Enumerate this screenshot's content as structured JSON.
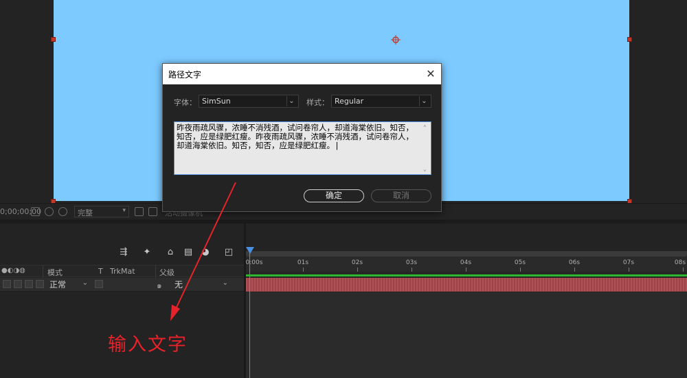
{
  "viewer": {
    "timecode": "0;00;00;00",
    "resolution": "完整",
    "extra_label": "活动摄像机"
  },
  "timeline": {
    "headers": {
      "mode": "模式",
      "t": "T",
      "trkmat": "TrkMat",
      "parent": "父级"
    },
    "row": {
      "mode_value": "正常",
      "parent_value": "无"
    },
    "ticks": [
      "0:00s",
      "01s",
      "02s",
      "03s",
      "04s",
      "05s",
      "06s",
      "07s",
      "08s"
    ]
  },
  "dialog": {
    "title": "路径文字",
    "font_label": "字体：",
    "font_value": "SimSun",
    "style_label": "样式：",
    "style_value": "Regular",
    "text": "昨夜雨疏风骤，浓睡不消残酒，试问卷帘人，却道海棠依旧。知否，知否，应是绿肥红瘦。昨夜雨疏风骤，浓睡不消残酒，试问卷帘人，却道海棠依旧。知否，知否，应是绿肥红瘦。|",
    "ok_label": "确定",
    "cancel_label": "取消"
  },
  "annotation": {
    "text": "输入文字",
    "color": "#e8222a"
  },
  "colors": {
    "comp_background": "#7ccaff",
    "layer_bar": "#a8484d",
    "playhead": "#4a90e2"
  }
}
